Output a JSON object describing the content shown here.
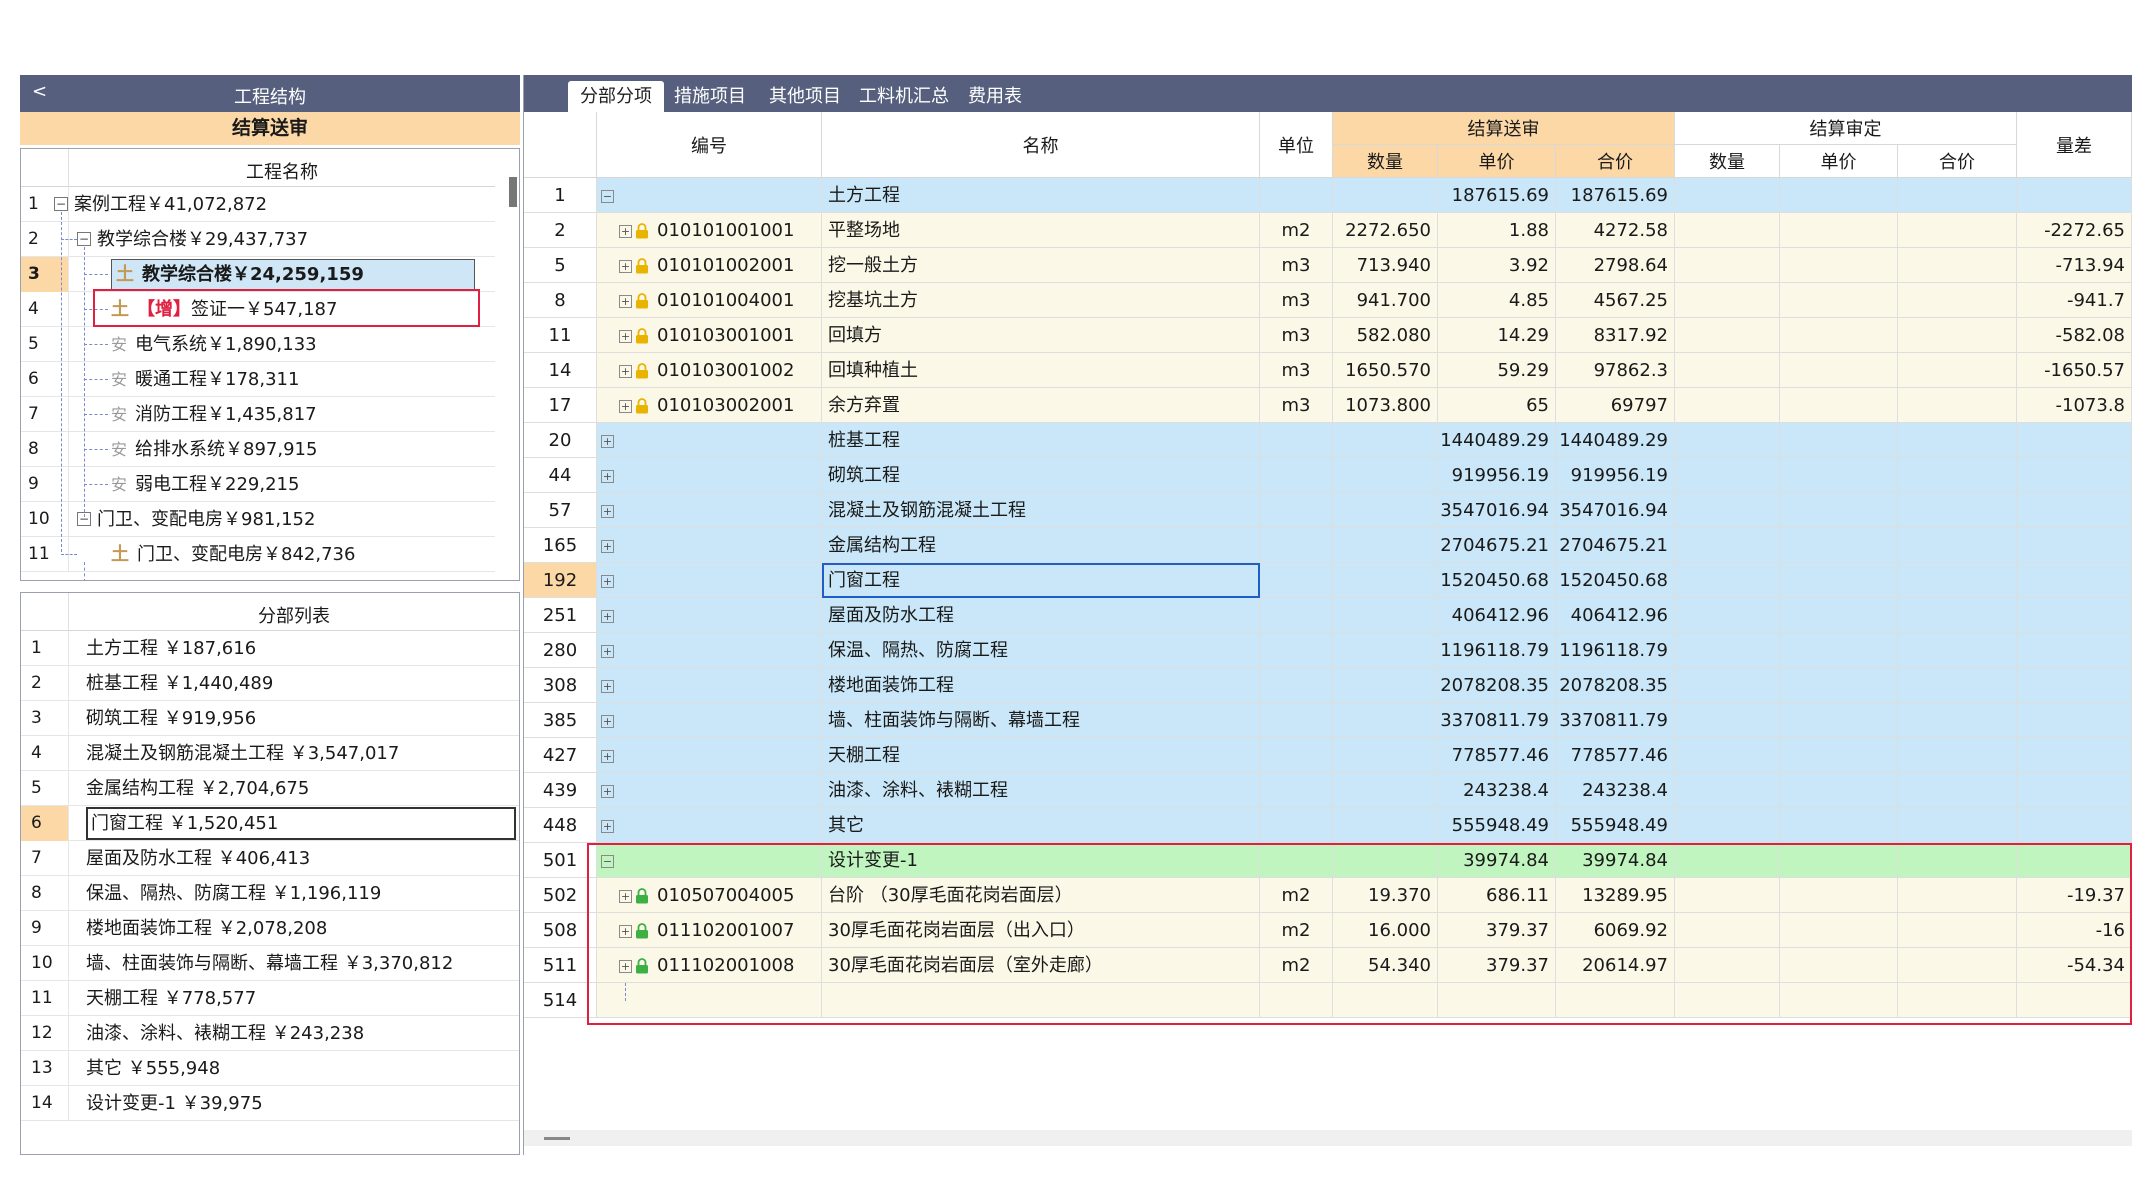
{
  "left": {
    "collapse_glyph": "<",
    "header": "工程结构",
    "sub_header": "结算送审",
    "tree_col": "工程名称",
    "tree": [
      {
        "n": "1",
        "label": "案例工程￥41,072,872",
        "ctl": "−"
      },
      {
        "n": "2",
        "label": "教学综合楼￥29,437,737",
        "ctl": "−"
      },
      {
        "n": "3",
        "icon": "土",
        "label": "教学综合楼￥24,259,159"
      },
      {
        "n": "4",
        "icon": "土",
        "tag": "【增】",
        "label": "签证一￥547,187"
      },
      {
        "n": "5",
        "icon": "安",
        "label": "电气系统￥1,890,133"
      },
      {
        "n": "6",
        "icon": "安",
        "label": "暖通工程￥178,311"
      },
      {
        "n": "7",
        "icon": "安",
        "label": "消防工程￥1,435,817"
      },
      {
        "n": "8",
        "icon": "安",
        "label": "给排水系统￥897,915"
      },
      {
        "n": "9",
        "icon": "安",
        "label": "弱电工程￥229,215"
      },
      {
        "n": "10",
        "label": "门卫、变配电房￥981,152",
        "ctl": "−"
      },
      {
        "n": "11",
        "icon": "土",
        "label": "门卫、变配电房￥842,736"
      }
    ],
    "list_col": "分部列表",
    "list": [
      {
        "n": "1",
        "label": "土方工程 ￥187,616"
      },
      {
        "n": "2",
        "label": "桩基工程 ￥1,440,489"
      },
      {
        "n": "3",
        "label": "砌筑工程 ￥919,956"
      },
      {
        "n": "4",
        "label": "混凝土及钢筋混凝土工程 ￥3,547,017"
      },
      {
        "n": "5",
        "label": "金属结构工程 ￥2,704,675"
      },
      {
        "n": "6",
        "label": "门窗工程 ￥1,520,451"
      },
      {
        "n": "7",
        "label": "屋面及防水工程 ￥406,413"
      },
      {
        "n": "8",
        "label": "保温、隔热、防腐工程 ￥1,196,119"
      },
      {
        "n": "9",
        "label": "楼地面装饰工程 ￥2,078,208"
      },
      {
        "n": "10",
        "label": "墙、柱面装饰与隔断、幕墙工程 ￥3,370,812"
      },
      {
        "n": "11",
        "label": "天棚工程 ￥778,577"
      },
      {
        "n": "12",
        "label": "油漆、涂料、裱糊工程 ￥243,238"
      },
      {
        "n": "13",
        "label": "其它 ￥555,948"
      },
      {
        "n": "14",
        "label": "设计变更-1 ￥39,975"
      }
    ]
  },
  "tabs": [
    "分部分项",
    "措施项目",
    "其他项目",
    "工料机汇总",
    "费用表"
  ],
  "grid": {
    "headers": {
      "code": "编号",
      "name": "名称",
      "unit": "单位",
      "submit": "结算送审",
      "review": "结算审定",
      "qty": "数量",
      "price": "单价",
      "total": "合价",
      "diff": "量差"
    },
    "rows": [
      {
        "n": "1",
        "style": "blue",
        "exp": "−",
        "code": "",
        "name": "土方工程",
        "unit": "",
        "qty": "",
        "price": "187615.69",
        "total": "187615.69",
        "diff": ""
      },
      {
        "n": "2",
        "style": "cream",
        "exp": "+",
        "lock": "gold",
        "code": "010101001001",
        "name": "平整场地",
        "unit": "m2",
        "qty": "2272.650",
        "price": "1.88",
        "total": "4272.58",
        "diff": "-2272.65"
      },
      {
        "n": "5",
        "style": "cream",
        "exp": "+",
        "lock": "gold",
        "code": "010101002001",
        "name": "挖一般土方",
        "unit": "m3",
        "qty": "713.940",
        "price": "3.92",
        "total": "2798.64",
        "diff": "-713.94"
      },
      {
        "n": "8",
        "style": "cream",
        "exp": "+",
        "lock": "gold",
        "code": "010101004001",
        "name": "挖基坑土方",
        "unit": "m3",
        "qty": "941.700",
        "price": "4.85",
        "total": "4567.25",
        "diff": "-941.7"
      },
      {
        "n": "11",
        "style": "cream",
        "exp": "+",
        "lock": "gold",
        "code": "010103001001",
        "name": "回填方",
        "unit": "m3",
        "qty": "582.080",
        "price": "14.29",
        "total": "8317.92",
        "diff": "-582.08"
      },
      {
        "n": "14",
        "style": "cream",
        "exp": "+",
        "lock": "gold",
        "code": "010103001002",
        "name": "回填种植土",
        "unit": "m3",
        "qty": "1650.570",
        "price": "59.29",
        "total": "97862.3",
        "diff": "-1650.57"
      },
      {
        "n": "17",
        "style": "cream",
        "exp": "+",
        "lock": "gold",
        "code": "010103002001",
        "name": "余方弃置",
        "unit": "m3",
        "qty": "1073.800",
        "price": "65",
        "total": "69797",
        "diff": "-1073.8"
      },
      {
        "n": "20",
        "style": "blue",
        "exp": "+",
        "code": "",
        "name": "桩基工程",
        "unit": "",
        "qty": "",
        "price": "1440489.29",
        "total": "1440489.29",
        "diff": ""
      },
      {
        "n": "44",
        "style": "blue",
        "exp": "+",
        "code": "",
        "name": "砌筑工程",
        "unit": "",
        "qty": "",
        "price": "919956.19",
        "total": "919956.19",
        "diff": ""
      },
      {
        "n": "57",
        "style": "blue",
        "exp": "+",
        "code": "",
        "name": "混凝土及钢筋混凝土工程",
        "unit": "",
        "qty": "",
        "price": "3547016.94",
        "total": "3547016.94",
        "diff": ""
      },
      {
        "n": "165",
        "style": "blue",
        "exp": "+",
        "code": "",
        "name": "金属结构工程",
        "unit": "",
        "qty": "",
        "price": "2704675.21",
        "total": "2704675.21",
        "diff": ""
      },
      {
        "n": "192",
        "style": "blue",
        "exp": "+",
        "code": "",
        "name": "门窗工程",
        "unit": "",
        "qty": "",
        "price": "1520450.68",
        "total": "1520450.68",
        "diff": ""
      },
      {
        "n": "251",
        "style": "blue",
        "exp": "+",
        "code": "",
        "name": "屋面及防水工程",
        "unit": "",
        "qty": "",
        "price": "406412.96",
        "total": "406412.96",
        "diff": ""
      },
      {
        "n": "280",
        "style": "blue",
        "exp": "+",
        "code": "",
        "name": "保温、隔热、防腐工程",
        "unit": "",
        "qty": "",
        "price": "1196118.79",
        "total": "1196118.79",
        "diff": ""
      },
      {
        "n": "308",
        "style": "blue",
        "exp": "+",
        "code": "",
        "name": "楼地面装饰工程",
        "unit": "",
        "qty": "",
        "price": "2078208.35",
        "total": "2078208.35",
        "diff": ""
      },
      {
        "n": "385",
        "style": "blue",
        "exp": "+",
        "code": "",
        "name": "墙、柱面装饰与隔断、幕墙工程",
        "unit": "",
        "qty": "",
        "price": "3370811.79",
        "total": "3370811.79",
        "diff": ""
      },
      {
        "n": "427",
        "style": "blue",
        "exp": "+",
        "code": "",
        "name": "天棚工程",
        "unit": "",
        "qty": "",
        "price": "778577.46",
        "total": "778577.46",
        "diff": ""
      },
      {
        "n": "439",
        "style": "blue",
        "exp": "+",
        "code": "",
        "name": "油漆、涂料、裱糊工程",
        "unit": "",
        "qty": "",
        "price": "243238.4",
        "total": "243238.4",
        "diff": ""
      },
      {
        "n": "448",
        "style": "blue",
        "exp": "+",
        "code": "",
        "name": "其它",
        "unit": "",
        "qty": "",
        "price": "555948.49",
        "total": "555948.49",
        "diff": ""
      },
      {
        "n": "501",
        "style": "green",
        "exp": "−",
        "code": "",
        "name": "设计变更-1",
        "unit": "",
        "qty": "",
        "price": "39974.84",
        "total": "39974.84",
        "diff": ""
      },
      {
        "n": "502",
        "style": "cream",
        "exp": "+",
        "lock": "green",
        "code": "010507004005",
        "name": "台阶 （30厚毛面花岗岩面层）",
        "unit": "m2",
        "qty": "19.370",
        "price": "686.11",
        "total": "13289.95",
        "diff": "-19.37"
      },
      {
        "n": "508",
        "style": "cream",
        "exp": "+",
        "lock": "green",
        "code": "011102001007",
        "name": "30厚毛面花岗岩面层（出入口）",
        "unit": "m2",
        "qty": "16.000",
        "price": "379.37",
        "total": "6069.92",
        "diff": "-16"
      },
      {
        "n": "511",
        "style": "cream",
        "exp": "+",
        "lock": "green",
        "code": "011102001008",
        "name": "30厚毛面花岗岩面层（室外走廊）",
        "unit": "m2",
        "qty": "54.340",
        "price": "379.37",
        "total": "20614.97",
        "diff": "-54.34"
      },
      {
        "n": "514",
        "style": "cream",
        "code": "",
        "name": "",
        "unit": "",
        "qty": "",
        "price": "",
        "total": "",
        "diff": ""
      }
    ]
  },
  "colors": {
    "header_bg": "#56607e",
    "peach": "#fcd8a7",
    "group_blue": "#c9e7f8",
    "item_cream": "#fcf8e8",
    "change_green": "#c0f5c0",
    "highlight_red": "#e02040",
    "selection_blue": "#1d5fc7"
  }
}
